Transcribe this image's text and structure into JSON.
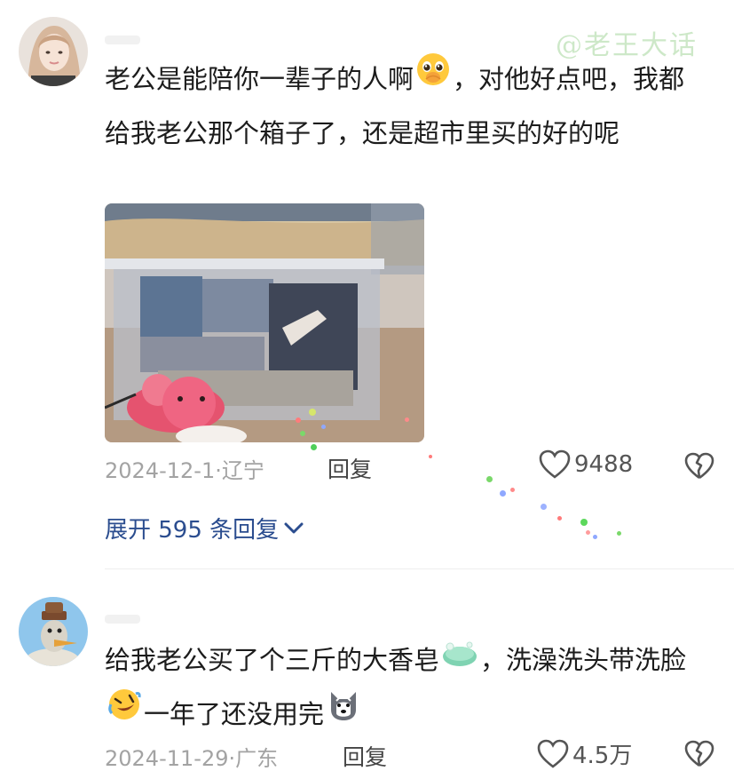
{
  "watermark": "@老王大话",
  "comments": [
    {
      "text_part1": "老公是能陪你一辈子的人啊",
      "emoji1": "pleading-face-icon",
      "text_part2": "，对他好点吧，我都给我老公那个箱子了，还是超市里买的好的呢",
      "date_location": "2024-12-1·辽宁",
      "reply_label": "回复",
      "likes": "9488",
      "expand_replies": "展开 595 条回复"
    },
    {
      "text_part1": "给我老公买了个三斤的大香皂",
      "emoji1": "soap-icon",
      "text_part2": "，洗澡洗头带洗脸",
      "emoji2": "rofl-icon",
      "text_part3": "一年了还没用完",
      "emoji3": "husky-dog-icon",
      "date_location": "2024-11-29·广东",
      "reply_label": "回复",
      "likes": "4.5万"
    }
  ],
  "colors": {
    "link_blue": "#2b4d8f",
    "meta_gray": "#a3a3a3",
    "watermark_green": "#cde8c8"
  }
}
